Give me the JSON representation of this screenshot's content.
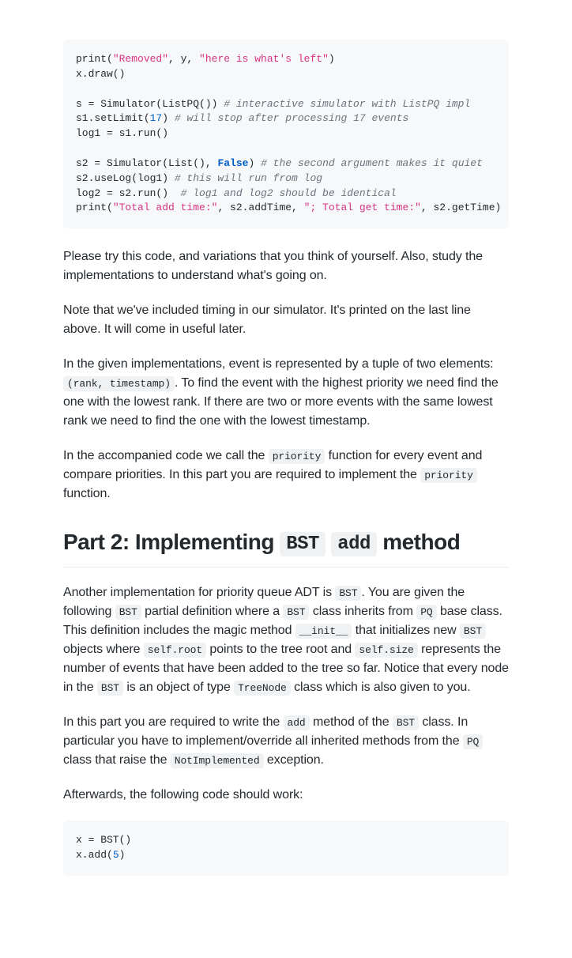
{
  "code1": {
    "l1": {
      "a": "print(",
      "b": "\"Removed\"",
      "c": ", y, ",
      "d": "\"here is what's left\"",
      "e": ")"
    },
    "l2": "x.draw()",
    "l3": "",
    "l4": {
      "a": "s = Simulator(ListPQ()) ",
      "b": "# interactive simulator with ListPQ impl"
    },
    "l5": {
      "a": "s1.setLimit(",
      "b": "17",
      "c": ") ",
      "d": "# will stop after processing 17 events"
    },
    "l6": "log1 = s1.run()",
    "l7": "",
    "l8": {
      "a": "s2 = Simulator(List(), ",
      "b": "False",
      "c": ") ",
      "d": "# the second argument makes it quiet"
    },
    "l9": {
      "a": "s2.useLog(log1) ",
      "b": "# this will run from log"
    },
    "l10": {
      "a": "log2 = s2.run()  ",
      "b": "# log1 and log2 should be identical"
    },
    "l11": {
      "a": "print(",
      "b": "\"Total add time:\"",
      "c": ", s2.addTime, ",
      "d": "\"; Total get time:\"",
      "e": ", s2.getTime)"
    }
  },
  "para1": "Please try this code, and variations that you think of yourself. Also, study the implementations to understand what's going on.",
  "para2": "Note that we've included timing in our simulator. It's printed on the last line above. It will come in useful later.",
  "para3a": "In the given implementations, event is represented by a tuple of two elements: ",
  "para3code": "(rank, timestamp)",
  "para3b": ". To find the event with the highest priority we need find the one with the lowest rank. If there are two or more events with the same lowest rank we need to find the one with the lowest timestamp.",
  "para4a": "In the accompanied code we call the ",
  "para4code1": "priority",
  "para4b": " function for every event and compare priorities. In this part you are required to implement the ",
  "para4code2": "priority",
  "para4c": " function.",
  "heading": {
    "a": "Part 2: Implementing ",
    "b": "BST",
    "c": "add",
    "d": " method"
  },
  "para5a": "Another implementation for priority queue ADT is ",
  "c_bst1": "BST",
  "para5b": ". You are given the following ",
  "c_bst2": "BST",
  "para5c": " partial definition where a ",
  "c_bst3": "BST",
  "para5d": " class inherits from ",
  "c_pq1": "PQ",
  "para5e": " base class. This definition includes the magic method ",
  "c_init": "__init__",
  "para5f": " that initializes new ",
  "c_bst4": "BST",
  "para5g": " objects where ",
  "c_root": "self.root",
  "para5h": " points to the tree root and ",
  "c_size": "self.size",
  "para5i": " represents the number of events that have been added to the tree so far. Notice that every node in the ",
  "c_bst5": "BST",
  "para5j": " is an object of type ",
  "c_tn": "TreeNode",
  "para5k": " class which is also given to you.",
  "para6a": "In this part you are required to write the ",
  "c_add": "add",
  "para6b": " method of the ",
  "c_bst6": "BST",
  "para6c": " class. In particular you have to implement/override all inherited methods from the ",
  "c_pq2": "PQ",
  "para6d": " class that raise the ",
  "c_ni": "NotImplemented",
  "para6e": " exception.",
  "para7": "Afterwards, the following code should work:",
  "code2": {
    "l1": "x = BST()",
    "l2a": "x.add(",
    "l2b": "5",
    "l2c": ")"
  }
}
